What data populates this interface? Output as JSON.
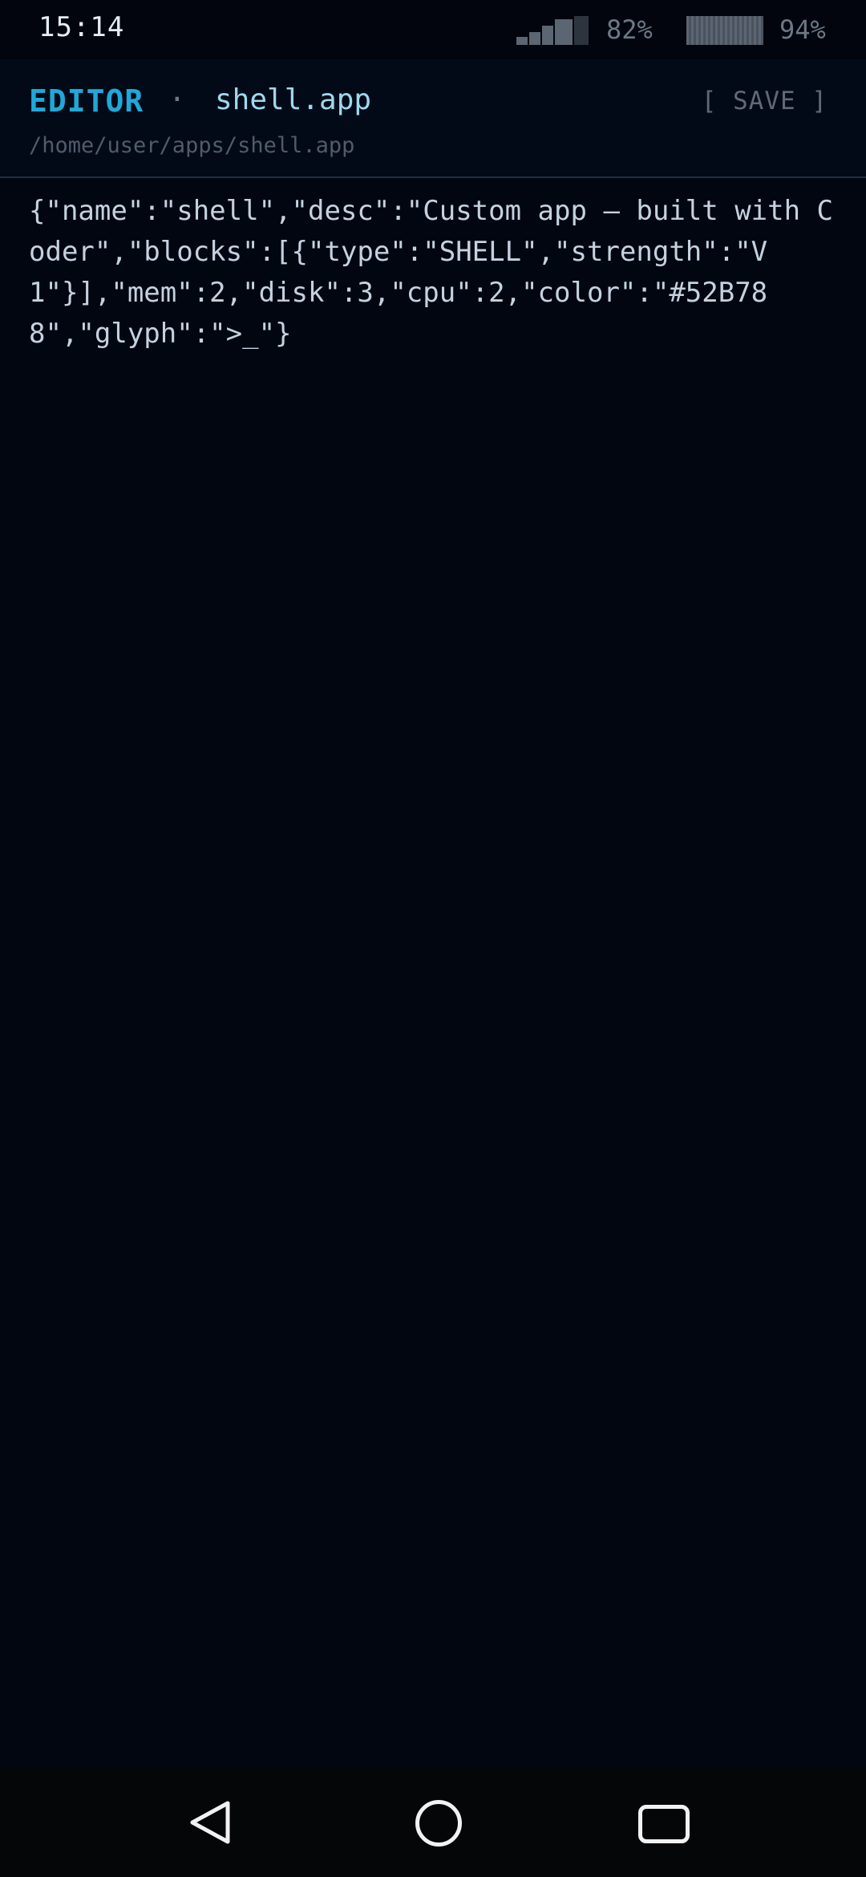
{
  "status_bar": {
    "time": "15:14",
    "signal_icon": "signal-strength-icon",
    "signal_percent": "82%",
    "battery_icon": "battery-icon",
    "battery_percent": "94%"
  },
  "header": {
    "title": "EDITOR",
    "separator": "·",
    "file_name": "shell.app",
    "save_label": "[ SAVE ]",
    "path": "/home/user/apps/shell.app"
  },
  "editor": {
    "content": "{\"name\":\"shell\",\"desc\":\"Custom app — built with Coder\",\"blocks\":[{\"type\":\"SHELL\",\"strength\":\"V1\"}],\"mem\":2,\"disk\":3,\"cpu\":2,\"color\":\"#52B788\",\"glyph\":\">_\"}"
  },
  "nav_bar": {
    "back_icon": "back-triangle-icon",
    "home_icon": "home-circle-icon",
    "recents_icon": "recents-square-icon"
  },
  "colors": {
    "background": "#020611",
    "accent": "#1fa8d8",
    "file_name": "#9fd8ee",
    "muted": "#5e6a78"
  }
}
